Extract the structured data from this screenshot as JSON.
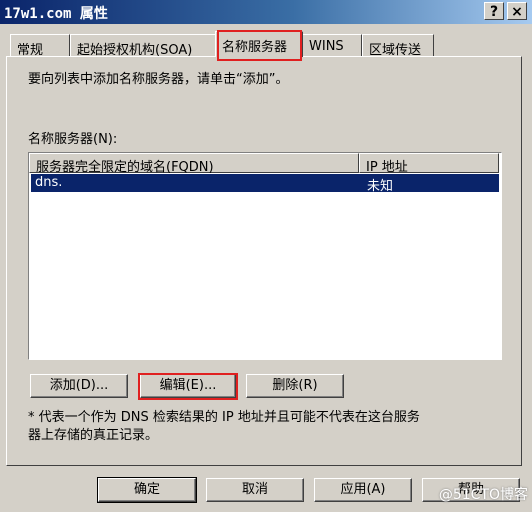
{
  "window": {
    "title": "17w1.com 属性",
    "help_glyph": "?",
    "close_glyph": "×"
  },
  "tabs": [
    {
      "label": "常规"
    },
    {
      "label": "起始授权机构(SOA)"
    },
    {
      "label": "名称服务器",
      "active": true
    },
    {
      "label": "WINS"
    },
    {
      "label": "区域传送"
    }
  ],
  "main": {
    "instruction": "要向列表中添加名称服务器，请单击“添加”。",
    "list_label": "名称服务器(N):",
    "columns": [
      "服务器完全限定的域名(FQDN)",
      "IP 地址"
    ],
    "rows": [
      {
        "fqdn": "dns.",
        "ip": "未知",
        "selected": true
      }
    ],
    "add_button": "添加(D)...",
    "edit_button": "编辑(E)...",
    "delete_button": "删除(R)",
    "footnote_line1": "* 代表一个作为 DNS 检索结果的 IP 地址并且可能不代表在这台服务",
    "footnote_line2": "器上存储的真正记录。"
  },
  "footer": {
    "ok_button": "确定",
    "cancel_button": "取消",
    "apply_button": "应用(A)",
    "help_button": "帮助"
  },
  "watermark": "@51CTO博客",
  "colors": {
    "dialog_bg": "#d4d0c8",
    "title_start": "#0a246a",
    "title_end": "#a6caf0",
    "selection": "#0a246a",
    "highlight_box": "#e02020"
  }
}
